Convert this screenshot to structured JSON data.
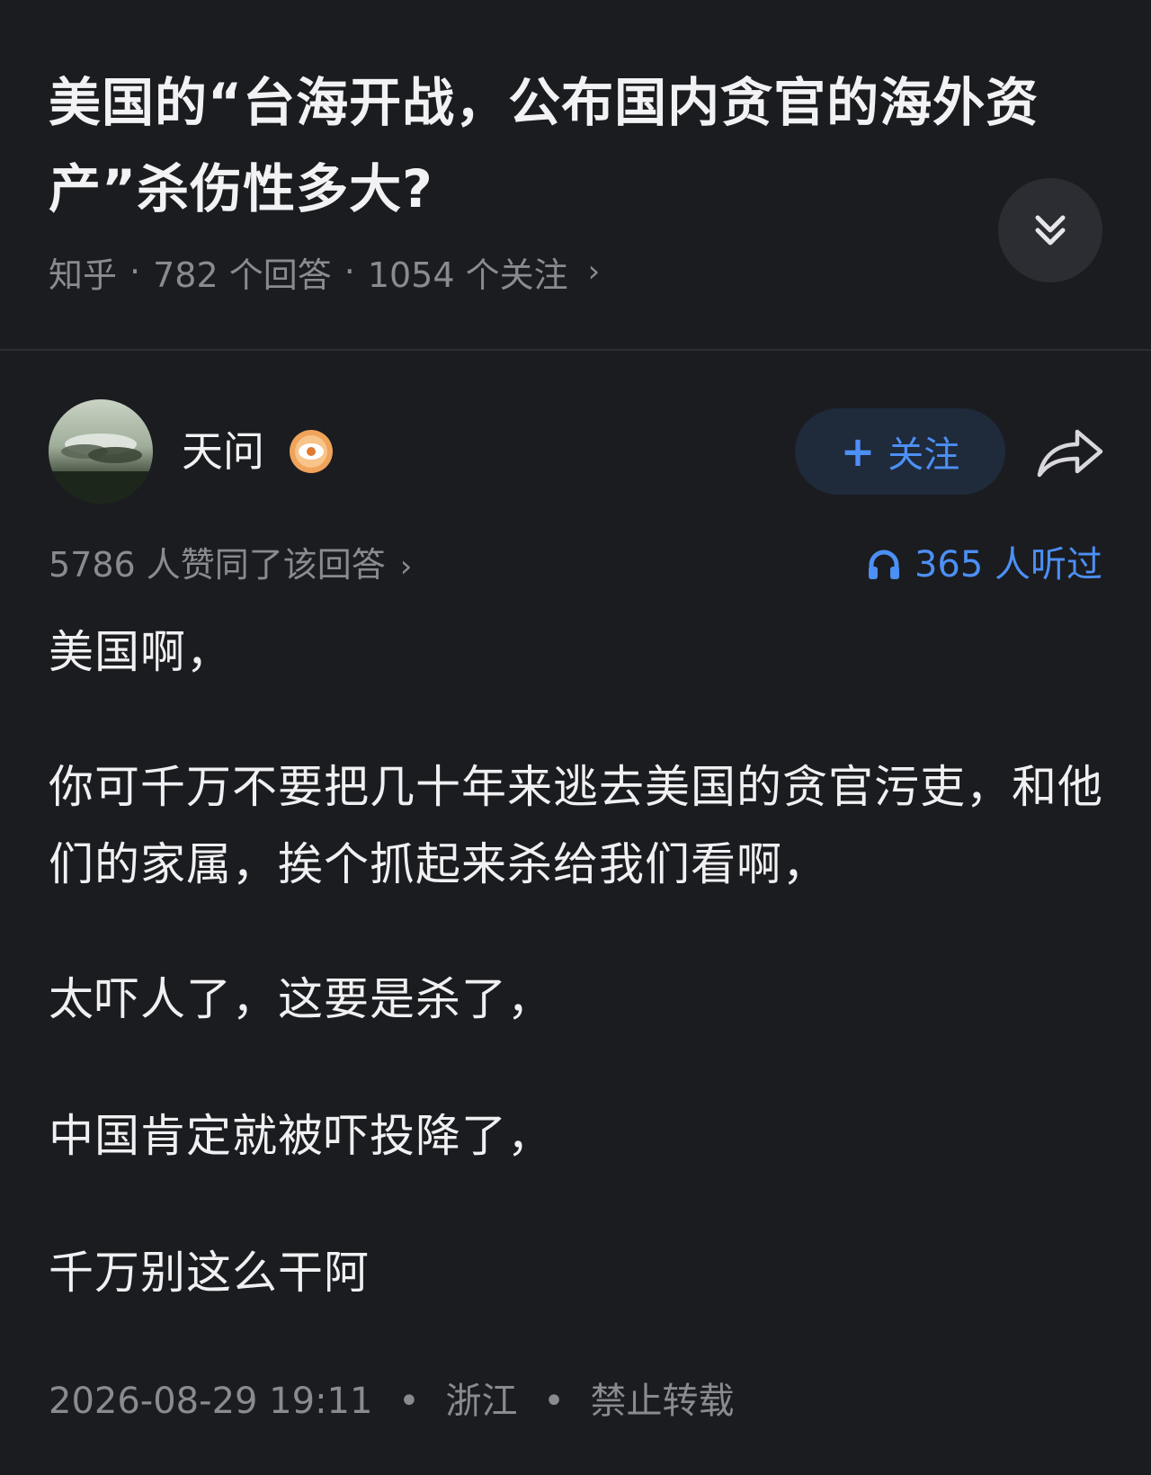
{
  "question": {
    "title": "美国的“台海开战，公布国内贪官的海外资产”杀伤性多大?",
    "source": "知乎",
    "answers": "782 个回答",
    "followers": "1054 个关注",
    "separator": "·",
    "chevron": "›"
  },
  "author": {
    "name": "天问",
    "follow_label": "关注",
    "follow_plus": "+"
  },
  "stats": {
    "likes": "5786 人赞同了该回答",
    "chevron": "›",
    "listened": "365 人听过"
  },
  "content": {
    "paragraphs": [
      "美国啊，",
      "你可千万不要把几十年来逃去美国的贪官污吏，和他们的家属，挨个抓起来杀给我们看啊，",
      "太吓人了，这要是杀了，",
      "中国肯定就被吓投降了，",
      "千万别这么干阿"
    ]
  },
  "footer": {
    "datetime": "2026-08-29 19:11",
    "location": "浙江",
    "copyright": "禁止转载",
    "separator": "•"
  },
  "colors": {
    "background": "#1b1c20",
    "accent": "#4c8ff5",
    "muted": "#8a8b91",
    "text": "#f0f0f2"
  }
}
